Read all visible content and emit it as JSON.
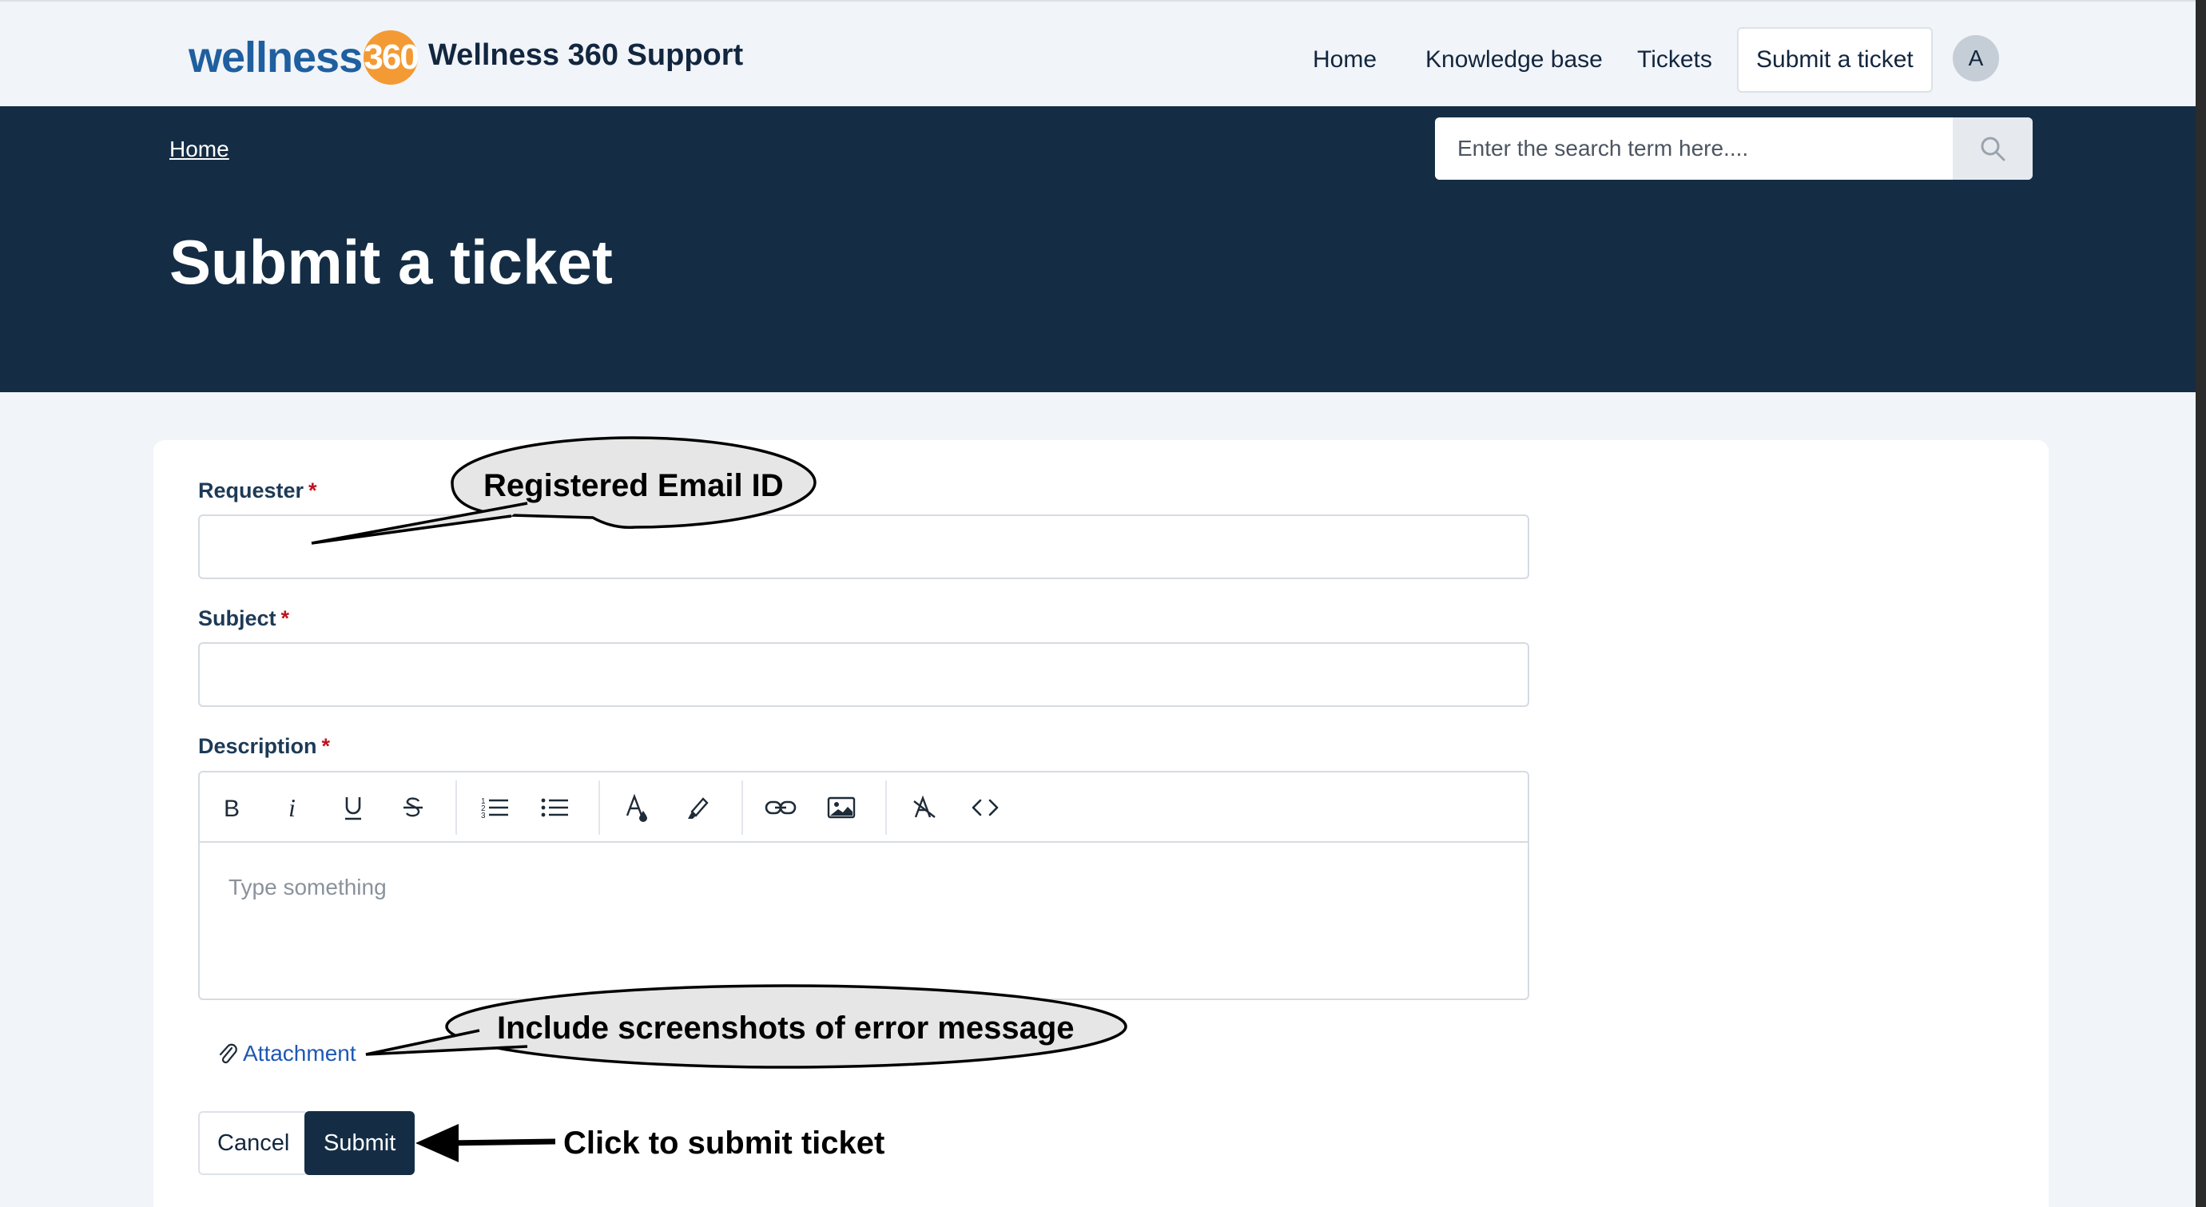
{
  "header": {
    "logo_word": "wellness",
    "logo_number": "360",
    "site_title": "Wellness 360 Support",
    "nav": [
      {
        "label": "Home"
      },
      {
        "label": "Knowledge base"
      },
      {
        "label": "Tickets"
      },
      {
        "label": "Submit a ticket",
        "active": true
      }
    ],
    "avatar_initial": "A"
  },
  "hero": {
    "breadcrumb": "Home",
    "search_placeholder": "Enter the search term here....",
    "title": "Submit a ticket"
  },
  "form": {
    "requester_label": "Requester",
    "subject_label": "Subject",
    "description_label": "Description",
    "required_marker": "*",
    "requester_value": "",
    "subject_value": "",
    "editor_placeholder": "Type something",
    "toolbar_icons": [
      "bold-icon",
      "italic-icon",
      "underline-icon",
      "strikethrough-icon",
      "ordered-list-icon",
      "bullet-list-icon",
      "text-color-icon",
      "highlight-icon",
      "link-icon",
      "image-icon",
      "clear-format-icon",
      "code-view-icon"
    ],
    "attachment_label": "Attachment",
    "cancel_label": "Cancel",
    "submit_label": "Submit"
  },
  "annotations": {
    "requester_callout": "Registered Email ID",
    "attachment_callout": "Include screenshots of error message",
    "submit_callout": "Click to submit ticket"
  },
  "colors": {
    "hero_bg": "#142d45",
    "accent_orange": "#f39a34",
    "logo_blue": "#1f5f9f",
    "required_red": "#c1121f",
    "link_blue": "#1e58b4"
  }
}
